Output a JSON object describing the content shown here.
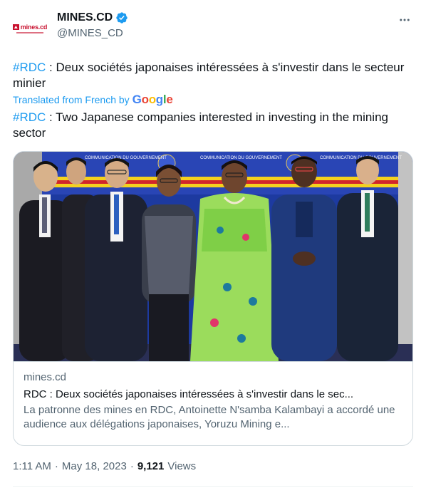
{
  "account": {
    "display_name": "MINES.CD",
    "handle": "@MINES_CD",
    "avatar_text": "mines.cd",
    "verified": true
  },
  "tweet": {
    "hashtag": "#RDC",
    "original_text": " : Deux sociétés japonaises intéressées à s'investir dans le secteur minier",
    "translated_label": "Translated from French by",
    "translator": "Google",
    "translation_hashtag": "#RDC",
    "translation_text": " : Two Japanese companies interested in investing in the mining sector"
  },
  "link_card": {
    "domain": "mines.cd",
    "title": "RDC : Deux sociétés japonaises intéressées à s'investir dans le sec...",
    "description": "La patronne des mines en RDC, Antoinette N'samba Kalambayi a accordé une audience aux délégations japonaises, Yoruzu Mining e...",
    "backdrop_text": [
      "COMMUNICATION DU GOUVERNEMENT",
      "COMMUNICATION DU GOUVERNEMENT",
      "COMMUNICATION DU GOUVERNEMENT"
    ]
  },
  "meta": {
    "time": "1:11 AM",
    "separator": "·",
    "date": "May 18, 2023",
    "views_count": "9,121",
    "views_label": "Views"
  },
  "colors": {
    "accent": "#1d9bf0",
    "text_primary": "#0f1419",
    "text_secondary": "#536471",
    "border": "#cfd9de",
    "logo_red": "#c8102e"
  },
  "icons": {
    "verified": "verified-badge-icon",
    "more": "more-horizontal-icon"
  }
}
